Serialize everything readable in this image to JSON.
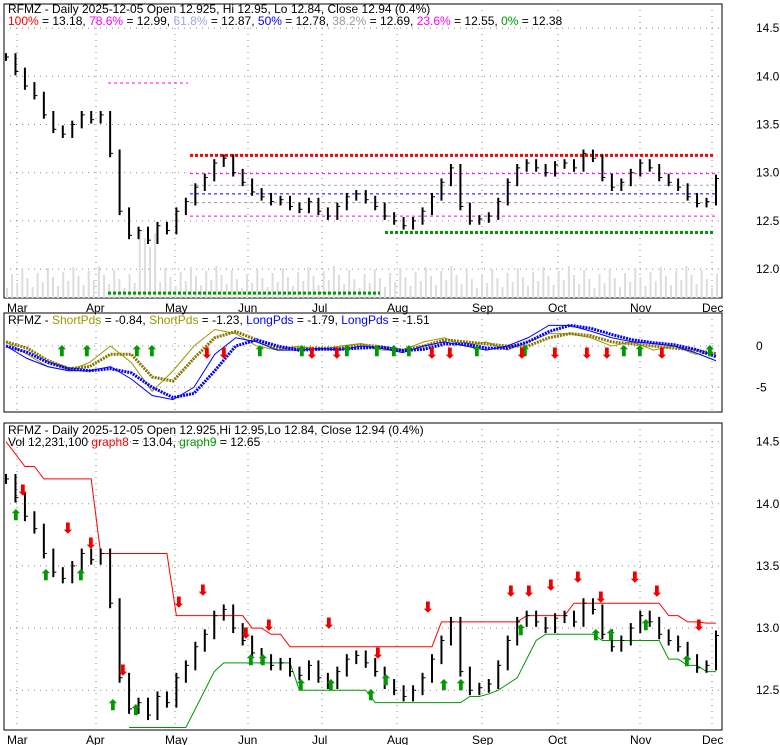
{
  "chart_data": [
    {
      "type": "line",
      "title": "RFMZ - Daily 2025-12-05 Open 12.925, Hi 12.95, Lo 12.84, Close 12.94 (0.4%)",
      "fib_legend": [
        {
          "label": "100%",
          "value": "= 13.18,",
          "color": "#ff0000",
          "level": 13.18
        },
        {
          "label": "78.6%",
          "value": "= 12.99,",
          "color": "#ff00ff",
          "level": 12.99
        },
        {
          "label": "61.8%",
          "value": "= 12.87,",
          "color": "#99aadd",
          "level": 12.87
        },
        {
          "label": "50%",
          "value": "= 12.78,",
          "color": "#0000ff",
          "level": 12.78
        },
        {
          "label": "38.2%",
          "value": "= 12.69,",
          "color": "#999999",
          "level": 12.69
        },
        {
          "label": "23.6%",
          "value": "= 12.55,",
          "color": "#ff00ff",
          "level": 12.55
        },
        {
          "label": "0%",
          "value": "= 12.38",
          "color": "#009900",
          "level": 12.38
        }
      ],
      "ylim": [
        11.7,
        14.75
      ],
      "yticks": [
        "14.5",
        "14.0",
        "13.5",
        "13.0",
        "12.5",
        "12.0"
      ],
      "ytick_values": [
        14.5,
        14.0,
        13.5,
        13.0,
        12.5,
        12.0
      ],
      "xticks": [
        "Mar",
        "Apr",
        "May",
        "Jun",
        "Jul",
        "Aug",
        "Sep",
        "Oct",
        "Nov",
        "Dec"
      ],
      "closes": [
        14.2,
        14.05,
        13.9,
        13.8,
        13.6,
        13.45,
        13.4,
        13.5,
        13.6,
        13.55,
        13.6,
        13.2,
        12.6,
        12.35,
        12.4,
        12.3,
        12.45,
        12.4,
        12.6,
        12.7,
        12.85,
        12.95,
        13.1,
        13.15,
        13.0,
        12.9,
        12.8,
        12.75,
        12.7,
        12.72,
        12.65,
        12.62,
        12.7,
        12.6,
        12.55,
        12.65,
        12.75,
        12.78,
        12.72,
        12.65,
        12.55,
        12.5,
        12.45,
        12.5,
        12.6,
        12.75,
        12.9,
        13.05,
        12.65,
        12.5,
        12.52,
        12.55,
        12.7,
        12.9,
        13.05,
        13.1,
        13.05,
        13.0,
        13.08,
        13.1,
        13.05,
        13.2,
        13.15,
        12.95,
        12.85,
        12.9,
        13.0,
        13.1,
        13.05,
        12.95,
        12.9,
        12.85,
        12.75,
        12.68,
        12.7,
        12.94
      ]
    },
    {
      "type": "line",
      "title_prefix": "RFMZ -",
      "legend": [
        {
          "label": "ShortPds",
          "value": "= -0.84,",
          "color": "#999900"
        },
        {
          "label": "ShortPds",
          "value": "= -1.23,",
          "color": "#999900"
        },
        {
          "label": "LongPds",
          "value": "= -1.79,",
          "color": "#0000ff"
        },
        {
          "label": "LongPds",
          "value": "= -1.51",
          "color": "#0000ff"
        }
      ],
      "ylim": [
        -8,
        4
      ],
      "yticks": [
        "0",
        "-5"
      ],
      "ytick_values": [
        0,
        -5
      ],
      "short": [
        0.5,
        -1,
        -2.5,
        -3,
        -2,
        0,
        -2,
        -5.5,
        -3,
        0,
        2,
        1.5,
        0,
        -0.5,
        0,
        -0.5,
        0,
        0.3,
        -0.5,
        -0.5,
        0.5,
        1,
        0,
        0.5,
        -0.5,
        0.5,
        1.5,
        1.5,
        1,
        0,
        0.5,
        -0.5,
        0,
        -1,
        -0.84
      ],
      "long": [
        0,
        -1.5,
        -2.5,
        -3,
        -3,
        -2.5,
        -4,
        -6,
        -6.5,
        -5,
        -1,
        1,
        0.5,
        -0.5,
        -0.5,
        -0.3,
        -0.5,
        0,
        -0.3,
        -0.8,
        0,
        0.5,
        0,
        -0.5,
        0,
        1,
        2.5,
        2.5,
        1.8,
        1,
        0.5,
        0.3,
        0,
        -0.8,
        -1.79
      ]
    },
    {
      "type": "line",
      "title": "RFMZ - Daily 2025-12-05 Open 12.925,Hi 12.95,Lo 12.84, Close 12.94 (0.4%)",
      "vol_label": "Vol 12,231,100",
      "legend": [
        {
          "label": "graph8",
          "value": "= 13.04,",
          "color": "#ff0000"
        },
        {
          "label": "graph9",
          "value": "= 12.65",
          "color": "#009900"
        }
      ],
      "ylim": [
        12.18,
        14.65
      ],
      "yticks": [
        "14.5",
        "14.0",
        "13.5",
        "13.0",
        "12.5"
      ],
      "ytick_values": [
        14.5,
        14.0,
        13.5,
        13.0,
        12.5
      ],
      "graph8": [
        14.5,
        14.4,
        14.3,
        14.3,
        14.2,
        14.2,
        14.2,
        14.2,
        14.2,
        14.2,
        13.6,
        13.6,
        13.6,
        13.6,
        13.6,
        13.6,
        13.6,
        13.6,
        13.1,
        13.1,
        13.1,
        13.1,
        13.1,
        13.1,
        13.1,
        13.1,
        13.0,
        13.0,
        12.95,
        12.95,
        12.85,
        12.85,
        12.85,
        12.85,
        12.85,
        12.85,
        12.85,
        12.85,
        12.85,
        12.85,
        12.85,
        12.85,
        12.85,
        12.85,
        12.85,
        12.85,
        13.05,
        13.05,
        13.05,
        13.05,
        13.05,
        13.05,
        13.05,
        13.05,
        13.05,
        13.1,
        13.1,
        13.1,
        13.1,
        13.1,
        13.2,
        13.2,
        13.2,
        13.2,
        13.2,
        13.2,
        13.2,
        13.2,
        13.2,
        13.2,
        13.1,
        13.1,
        13.05,
        13.05,
        13.04,
        13.04
      ],
      "graph9": [
        null,
        null,
        null,
        null,
        null,
        null,
        null,
        null,
        null,
        null,
        null,
        null,
        null,
        12.2,
        12.2,
        12.2,
        12.2,
        12.2,
        12.2,
        12.2,
        12.35,
        12.5,
        12.65,
        12.72,
        12.72,
        12.72,
        12.72,
        12.72,
        12.72,
        12.72,
        12.72,
        12.5,
        12.5,
        12.5,
        12.5,
        12.5,
        12.5,
        12.5,
        12.5,
        12.4,
        12.4,
        12.4,
        12.4,
        12.4,
        12.4,
        12.4,
        12.4,
        12.4,
        12.4,
        12.45,
        12.45,
        12.47,
        12.5,
        12.55,
        12.6,
        12.75,
        12.9,
        12.95,
        12.95,
        12.95,
        12.95,
        12.95,
        12.95,
        12.9,
        12.9,
        12.9,
        12.9,
        12.9,
        12.9,
        12.9,
        12.75,
        12.75,
        12.7,
        12.7,
        12.65,
        12.65
      ]
    }
  ]
}
